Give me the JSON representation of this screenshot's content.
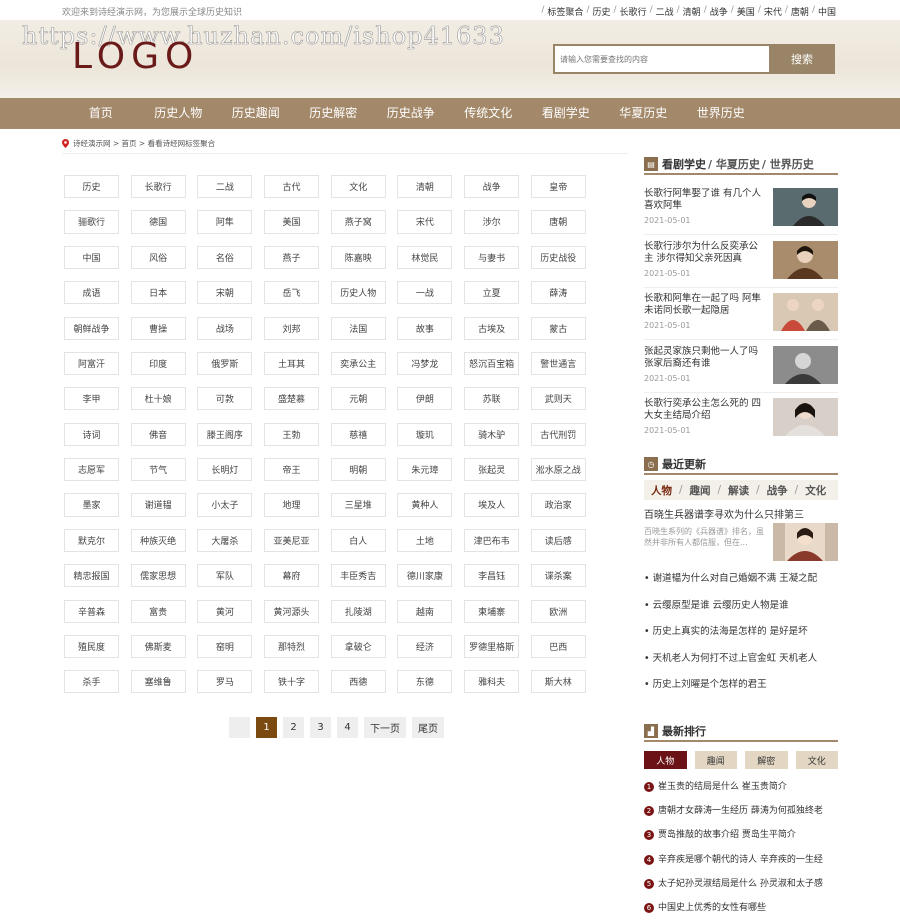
{
  "topbar": {
    "welcome": "欢迎来到诗经演示网，为您展示全球历史知识",
    "links": [
      "标签聚合",
      "历史",
      "长歌行",
      "二战",
      "清朝",
      "战争",
      "美国",
      "宋代",
      "唐朝",
      "中国"
    ]
  },
  "header": {
    "watermark": "https://www.huzhan.com/ishop41633",
    "logo": "LOGO",
    "search_placeholder": "请输入您需要查找的内容",
    "search_button": "搜索"
  },
  "nav": [
    "首页",
    "历史人物",
    "历史趣闻",
    "历史解密",
    "历史战争",
    "传统文化",
    "看剧学史",
    "华夏历史",
    "世界历史"
  ],
  "breadcrumb": [
    "诗经演示网",
    "首页",
    "看看诗经网标签聚合"
  ],
  "breadcrumb_sep": " > ",
  "tags": [
    "历史",
    "长歌行",
    "二战",
    "古代",
    "文化",
    "清朝",
    "战争",
    "皇帝",
    "骊歌行",
    "德国",
    "阿隼",
    "美国",
    "燕子窝",
    "宋代",
    "涉尔",
    "唐朝",
    "中国",
    "风俗",
    "名俗",
    "燕子",
    "陈嘉映",
    "林觉民",
    "与妻书",
    "历史战役",
    "成语",
    "日本",
    "宋朝",
    "岳飞",
    "历史人物",
    "一战",
    "立夏",
    "薛涛",
    "朝鲜战争",
    "曹操",
    "战场",
    "刘邦",
    "法国",
    "故事",
    "古埃及",
    "蒙古",
    "阿富汗",
    "印度",
    "俄罗斯",
    "土耳其",
    "奕承公主",
    "冯梦龙",
    "怒沉百宝箱",
    "警世通言",
    "李甲",
    "杜十娘",
    "可敦",
    "盛楚慕",
    "元朝",
    "伊朗",
    "苏联",
    "武则天",
    "诗词",
    "佛音",
    "滕王阁序",
    "王勃",
    "慈禧",
    "璇玑",
    "骑木驴",
    "古代刑罚",
    "志愿军",
    "节气",
    "长明灯",
    "帝王",
    "明朝",
    "朱元璋",
    "张起灵",
    "淞水原之战",
    "墨家",
    "谢道韫",
    "小太子",
    "地理",
    "三星堆",
    "黄种人",
    "埃及人",
    "政治家",
    "默克尔",
    "种族灭绝",
    "大屠杀",
    "亚美尼亚",
    "白人",
    "土地",
    "津巴布韦",
    "读后感",
    "精忠报国",
    "儒家思想",
    "军队",
    "幕府",
    "丰臣秀吉",
    "德川家康",
    "李昌钰",
    "谍杀案",
    "辛普森",
    "富贵",
    "黄河",
    "黄河源头",
    "扎陵湖",
    "越南",
    "柬埔寨",
    "欧洲",
    "殖民度",
    "佛斯麦",
    "窑明",
    "那特烈",
    "拿破仑",
    "经济",
    "罗德里格斯",
    "巴西",
    "杀手",
    "塞维鲁",
    "罗马",
    "铁十字",
    "西德",
    "东德",
    "雅科夫",
    "斯大林"
  ],
  "pager": {
    "pages": [
      "1",
      "2",
      "3",
      "4"
    ],
    "next": "下一页",
    "last": "尾页",
    "current": "1"
  },
  "sidebar": {
    "drama": {
      "title": "看剧学史",
      "sub1": "/ 华夏历史",
      "sub2": "/ 世界历史",
      "items": [
        {
          "title": "长歌行阿隼娶了谁 有几个人喜欢阿隼",
          "date": "2021-05-01"
        },
        {
          "title": "长歌行涉尔为什么反奕承公主 涉尔得知父亲死因真",
          "date": "2021-05-01"
        },
        {
          "title": "长歌和阿隼在一起了吗 阿隼未诺同长歌一起隐居",
          "date": "2021-05-01"
        },
        {
          "title": "张起灵家族只剩他一人了吗 张家后裔还有谁",
          "date": "2021-05-01"
        },
        {
          "title": "长歌行奕承公主怎么死的 四大女主结局介绍",
          "date": "2021-05-01"
        }
      ]
    },
    "latest": {
      "title": "最近更新",
      "tabs": [
        "人物",
        "趣闻",
        "解读",
        "战争",
        "文化"
      ],
      "top_title": "百晓生兵器谱李寻欢为什么只排第三",
      "top_desc": "百晓生系列的《兵器谱》排名，虽然并非所有人都信服，但在...",
      "items": [
        "谢道韫为什么对自己婚姻不满 王凝之配",
        "云缨原型是谁 云缨历史人物是谁",
        "历史上真实的法海是怎样的 是好是坏",
        "天机老人为何打不过上官金虹 天机老人",
        "历史上刘曜是个怎样的君王"
      ]
    },
    "ranking": {
      "title": "最新排行",
      "tabs": [
        "人物",
        "趣闻",
        "解密",
        "文化"
      ],
      "items": [
        "崔玉贵的结局是什么 崔玉贵简介",
        "唐朝才女薛涛一生经历 薛涛为何孤独终老",
        "贾岛推敲的故事介绍 贾岛生平简介",
        "辛弃疾是哪个朝代的诗人 辛弃疾的一生经",
        "太子妃孙灵淑结局是什么 孙灵淑和太子感",
        "中国史上优秀的女性有哪些"
      ]
    }
  },
  "colors": {
    "nav": "#a3896a",
    "accent": "#7a1414",
    "header_bg": "#ece5d9"
  }
}
